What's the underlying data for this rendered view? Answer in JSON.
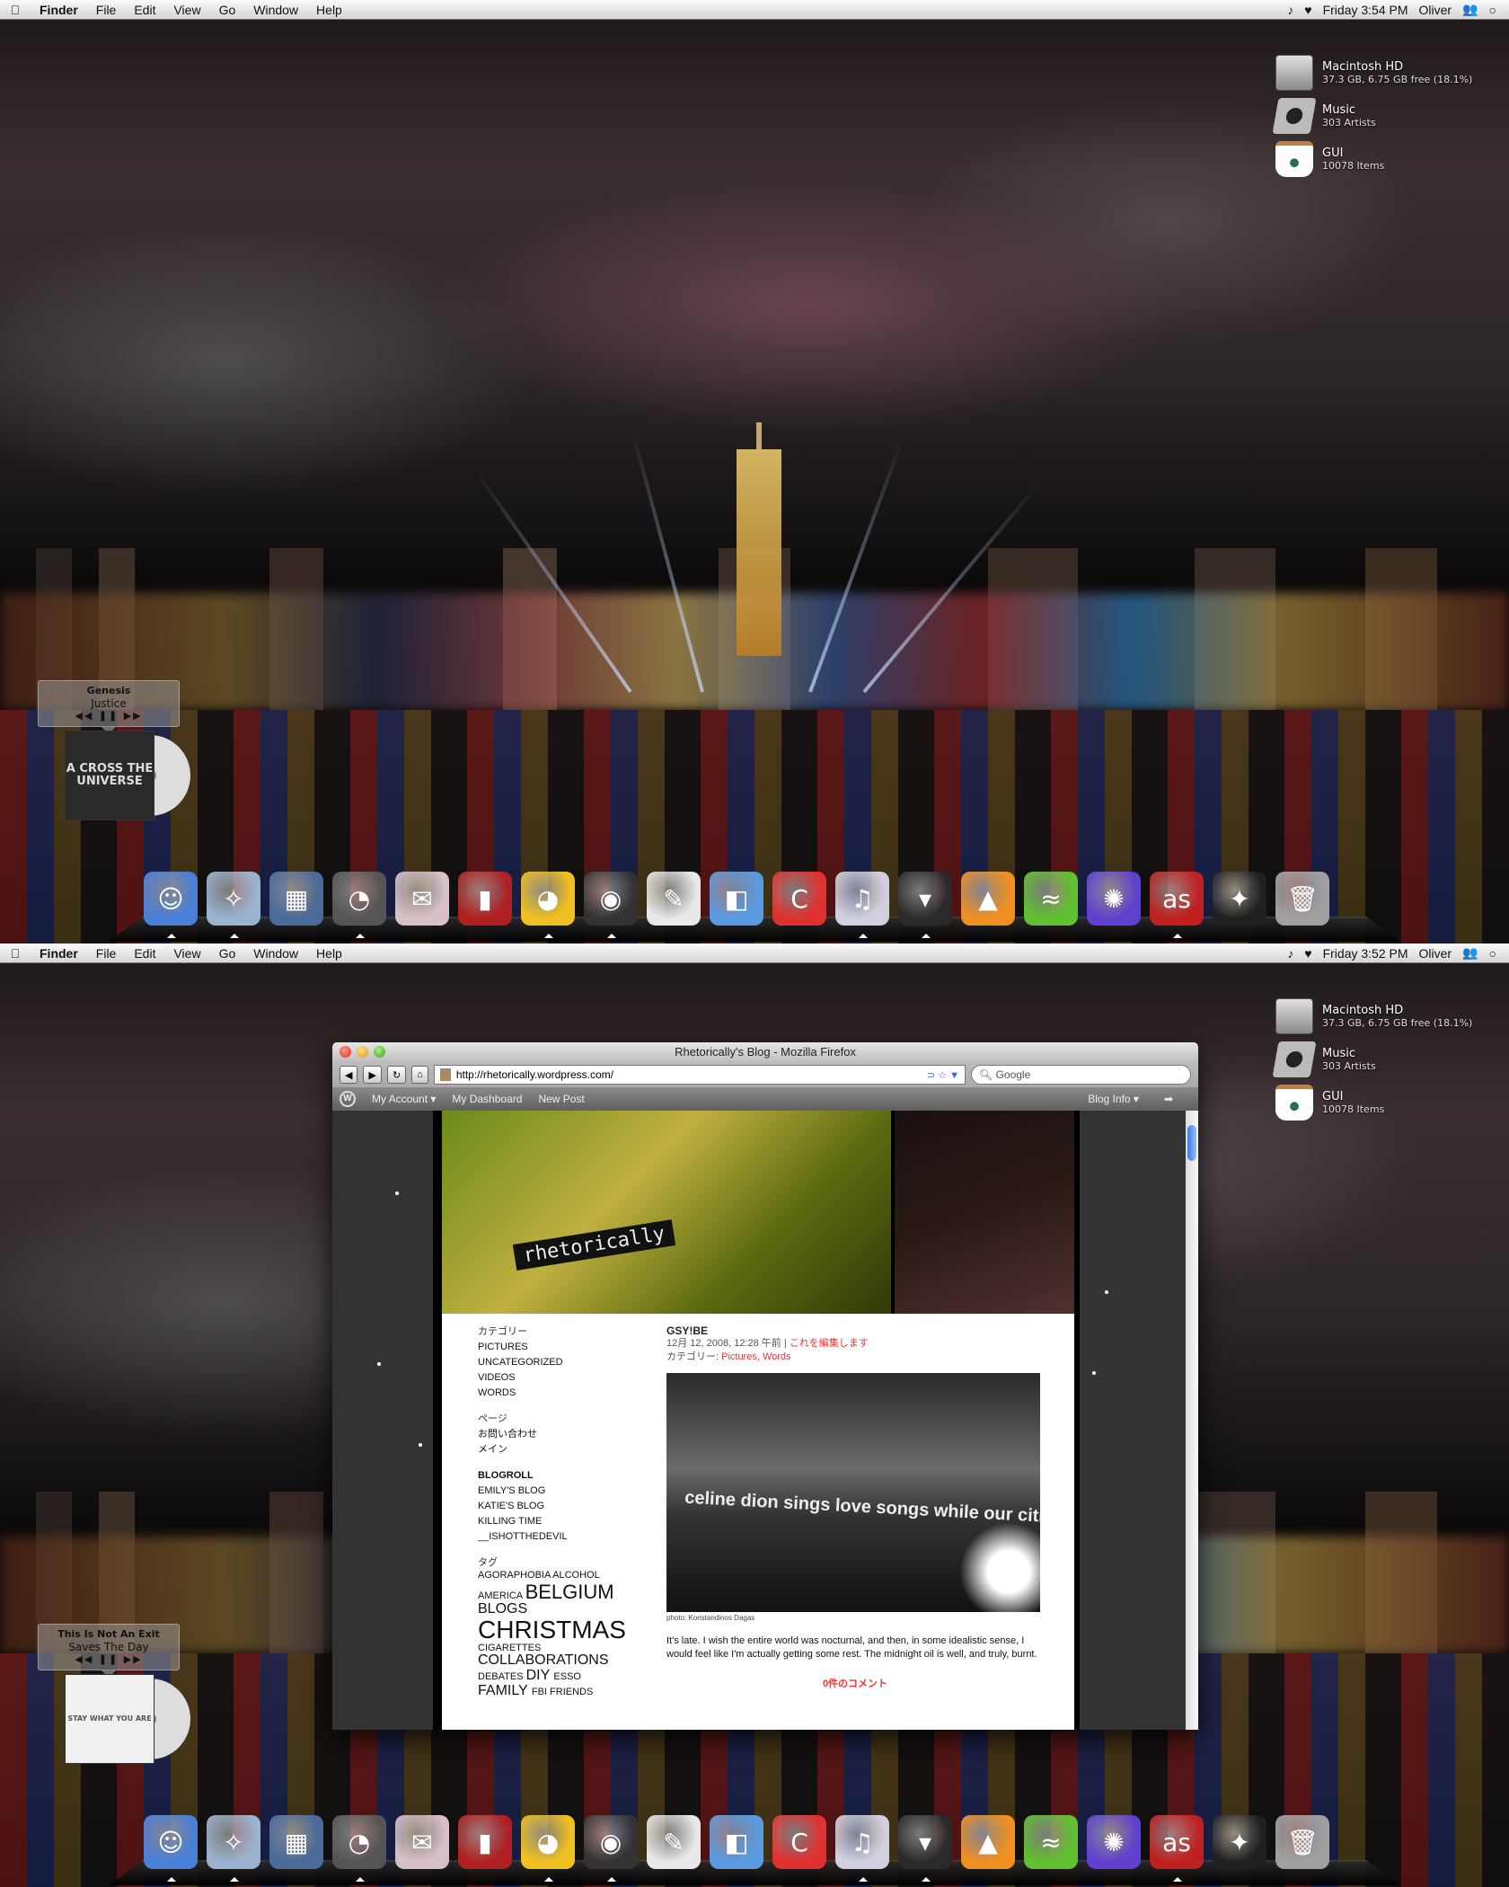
{
  "screens": [
    {
      "menubar": {
        "apple": "",
        "menus": [
          "Finder",
          "File",
          "Edit",
          "View",
          "Go",
          "Window",
          "Help"
        ],
        "clock": "Friday 3:54 PM",
        "user": "Oliver"
      },
      "now_playing": {
        "track": "Genesis",
        "artist": "Justice",
        "controls": "◀◀ ❚❚ ▶▶",
        "album_text": "A CROSS THE UNIVERSE"
      }
    },
    {
      "menubar": {
        "apple": "",
        "menus": [
          "Finder",
          "File",
          "Edit",
          "View",
          "Go",
          "Window",
          "Help"
        ],
        "clock": "Friday 3:52 PM",
        "user": "Oliver"
      },
      "now_playing": {
        "track": "This Is Not An Exit",
        "artist": "Saves The Day",
        "controls": "◀◀ ❚❚ ▶▶",
        "album_text": "STAY WHAT YOU ARE"
      }
    }
  ],
  "drives": [
    {
      "name": "Macintosh HD",
      "sub": "37.3 GB, 6.75 GB free (18.1%)",
      "icon": "hard-drive-icon"
    },
    {
      "name": "Music",
      "sub": "303 Artists",
      "icon": "speaker-icon"
    },
    {
      "name": "GUI",
      "sub": "10078 Items",
      "icon": "coffee-cup-icon"
    }
  ],
  "dock": [
    {
      "name": "Finder",
      "icon": "finder-icon",
      "running": true,
      "color": "#4a7fd8",
      "glyph": "☺"
    },
    {
      "name": "Safari",
      "icon": "compass-icon",
      "running": true,
      "color": "#9ab3d0",
      "glyph": "✧"
    },
    {
      "name": "Spaces",
      "icon": "spaces-icon",
      "running": false,
      "color": "#4a6a9a",
      "glyph": "▦"
    },
    {
      "name": "Dashboard",
      "icon": "gauge-icon",
      "running": true,
      "color": "#555555",
      "glyph": "◔"
    },
    {
      "name": "Mail",
      "icon": "stamp-icon",
      "running": false,
      "color": "#d8c0c8",
      "glyph": "✉"
    },
    {
      "name": "Photo Booth",
      "icon": "photo-booth-icon",
      "running": false,
      "color": "#b02020",
      "glyph": "▮"
    },
    {
      "name": "Cyberduck",
      "icon": "duck-icon",
      "running": true,
      "color": "#f0c020",
      "glyph": "◕"
    },
    {
      "name": "Camera",
      "icon": "camera-icon",
      "running": true,
      "color": "#333333",
      "glyph": "◉"
    },
    {
      "name": "Sketch",
      "icon": "sketch-icon",
      "running": false,
      "color": "#e8e8e8",
      "glyph": "✎"
    },
    {
      "name": "Icon Composer",
      "icon": "icon-composer-icon",
      "running": false,
      "color": "#5a9ae0",
      "glyph": "◧"
    },
    {
      "name": "Coda",
      "icon": "candy-icon",
      "running": false,
      "color": "#e03030",
      "glyph": "C"
    },
    {
      "name": "iTunes",
      "icon": "itunes-icon",
      "running": true,
      "color": "#d0d0e0",
      "glyph": "♫"
    },
    {
      "name": "Adium",
      "icon": "tuxedo-icon",
      "running": true,
      "color": "#2a2a2a",
      "glyph": "▾"
    },
    {
      "name": "VLC",
      "icon": "traffic-cone-icon",
      "running": false,
      "color": "#f09020",
      "glyph": "▲"
    },
    {
      "name": "Gator",
      "icon": "alligator-icon",
      "running": false,
      "color": "#60c030",
      "glyph": "≈"
    },
    {
      "name": "Fiber",
      "icon": "fiber-optic-icon",
      "running": false,
      "color": "#6040d0",
      "glyph": "✺"
    },
    {
      "name": "Last.fm",
      "icon": "lastfm-icon",
      "running": true,
      "color": "#c02020",
      "glyph": "as"
    },
    {
      "name": "Magic",
      "icon": "magic-wand-icon",
      "running": false,
      "color": "#202020",
      "glyph": "✦"
    },
    {
      "name": "Trash",
      "icon": "trash-icon",
      "running": false,
      "color": "#a0a0a0",
      "glyph": "🗑"
    }
  ],
  "firefox": {
    "title": "Rhetorically's Blog - Mozilla Firefox",
    "url": "http://rhetorically.wordpress.com/",
    "search_placeholder": "Google",
    "back": "◀",
    "forward": "▶",
    "reload": "↻",
    "home": "⌂",
    "url_actions": "⊃ ☆ ▼",
    "wpbar": {
      "my_account": "My Account ▾",
      "dashboard": "My Dashboard",
      "new_post": "New Post",
      "blog_info": "Blog Info ▾",
      "arrow": "➡"
    }
  },
  "blog": {
    "title": "rhetorically",
    "sidebar": {
      "categories_heading": "カテゴリー",
      "categories": [
        "PICTURES",
        "UNCATEGORIZED",
        "VIDEOS",
        "WORDS"
      ],
      "pages_heading": "ページ",
      "pages": [
        "お問い合わせ",
        "メイン"
      ],
      "blogroll_heading": "BLOGROLL",
      "blogroll": [
        "EMILY'S BLOG",
        "KATIE'S BLOG",
        "KILLING TIME",
        "__ISHOTTHEDEVIL"
      ],
      "tags_heading": "タグ",
      "tags": [
        {
          "label": "AGORAPHOBIA",
          "weight": 1
        },
        {
          "label": "ALCOHOL",
          "weight": 1
        },
        {
          "label": "AMERICA",
          "weight": 1
        },
        {
          "label": "BELGIUM",
          "weight": 3
        },
        {
          "label": "BLOGS",
          "weight": 2
        },
        {
          "label": "CHRISTMAS",
          "weight": 4
        },
        {
          "label": "CIGARETTES",
          "weight": 1
        },
        {
          "label": "COLLABORATIONS",
          "weight": 2
        },
        {
          "label": "DEBATES",
          "weight": 1
        },
        {
          "label": "DIY",
          "weight": 2
        },
        {
          "label": "ESSO",
          "weight": 1
        },
        {
          "label": "FAMILY",
          "weight": 2
        },
        {
          "label": "FBI",
          "weight": 1
        },
        {
          "label": "FRIENDS",
          "weight": 1
        }
      ]
    },
    "post": {
      "title": "GSY!BE",
      "date": "12月 12, 2008, 12:28 午前 |",
      "edit_link": "これを編集します",
      "category_label": "カテゴリー:",
      "category_links": "Pictures, Words",
      "photo_text": "celine dion sings love songs while our cities burn",
      "credit": "photo: Konstandinos Dagas",
      "body": "It's late. I wish the entire world was nocturnal, and then, in some idealistic sense, I would feel like I'm actually getting some rest. The midnight oil is well, and truly, burnt.",
      "comments": "0件のコメント"
    }
  }
}
